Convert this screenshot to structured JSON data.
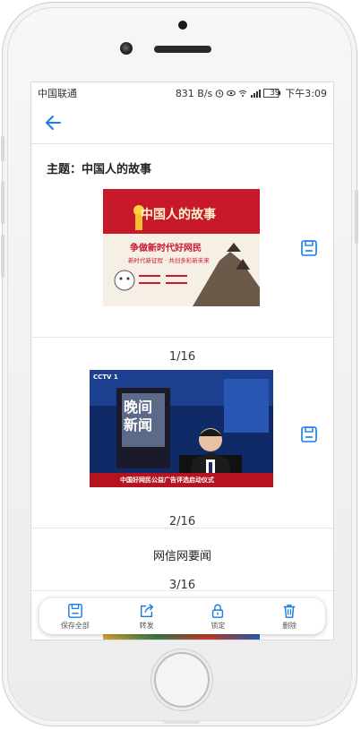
{
  "status": {
    "carrier": "中国联通",
    "speed": "831 B/s",
    "battery": "39",
    "time": "下午3:09"
  },
  "header": {
    "back_icon": "back-arrow-icon"
  },
  "topic": {
    "label": "主题：中国人的故事"
  },
  "images": [
    {
      "banner_title": "中国人的故事",
      "banner_sub1": "争做新时代好网民",
      "banner_sub2": "新时代新征程 · 共创多彩新未来"
    },
    {
      "tv_logo": "CCTV 1",
      "tv_show": "晚间新闻",
      "ticker": "中国好网民公益广告评选启动仪式"
    }
  ],
  "pages": [
    "1/16",
    "2/16",
    "3/16"
  ],
  "caption": "网信网要闻",
  "toolbar": [
    {
      "icon": "save-icon",
      "label": "保存全部"
    },
    {
      "icon": "share-icon",
      "label": "转发"
    },
    {
      "icon": "lock-icon",
      "label": "锁定"
    },
    {
      "icon": "trash-icon",
      "label": "删除"
    }
  ],
  "colors": {
    "accent": "#1a7be0",
    "banner_red": "#c8192b"
  }
}
